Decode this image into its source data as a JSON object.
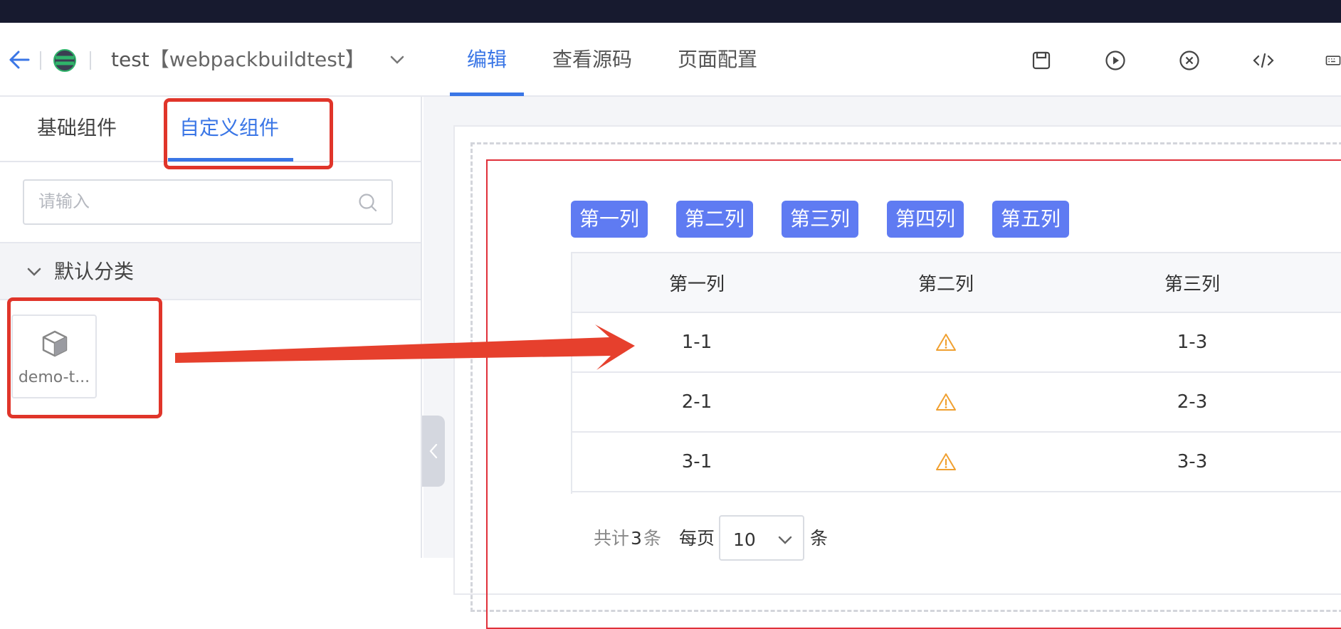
{
  "header": {
    "app_title": "test",
    "app_subtitle": "【webpackbuildtest】",
    "tabs": [
      {
        "label": "编辑",
        "active": true
      },
      {
        "label": "查看源码",
        "active": false
      },
      {
        "label": "页面配置",
        "active": false
      }
    ],
    "toolbar_icons": [
      "save-icon",
      "play-icon",
      "close-circle-icon",
      "code-icon",
      "keyboard-icon"
    ]
  },
  "left_panel": {
    "tabs": [
      {
        "label": "基础组件",
        "active": false
      },
      {
        "label": "自定义组件",
        "active": true
      }
    ],
    "search": {
      "placeholder": "请输入",
      "value": ""
    },
    "category": {
      "label": "默认分类",
      "expanded": true
    },
    "components": [
      {
        "label": "demo-t...",
        "icon": "cube-icon"
      }
    ]
  },
  "canvas": {
    "column_buttons": [
      "第一列",
      "第二列",
      "第三列",
      "第四列",
      "第五列"
    ],
    "table": {
      "headers": [
        "第一列",
        "第二列",
        "第三列"
      ],
      "rows": [
        {
          "c1": "1-1",
          "c2": "warning-icon",
          "c3": "1-3"
        },
        {
          "c1": "2-1",
          "c2": "warning-icon",
          "c3": "2-3"
        },
        {
          "c1": "3-1",
          "c2": "warning-icon",
          "c3": "3-3"
        }
      ]
    },
    "pagination": {
      "total_prefix": "共计",
      "total": "3",
      "total_suffix": "条",
      "per_page_label": "每页",
      "page_size": "10",
      "page_size_suffix": "条"
    }
  },
  "colors": {
    "accent": "#3a76e6",
    "column_button": "#5f7bf2",
    "annotation_red": "#e0352a",
    "topbar": "#171a2f"
  }
}
